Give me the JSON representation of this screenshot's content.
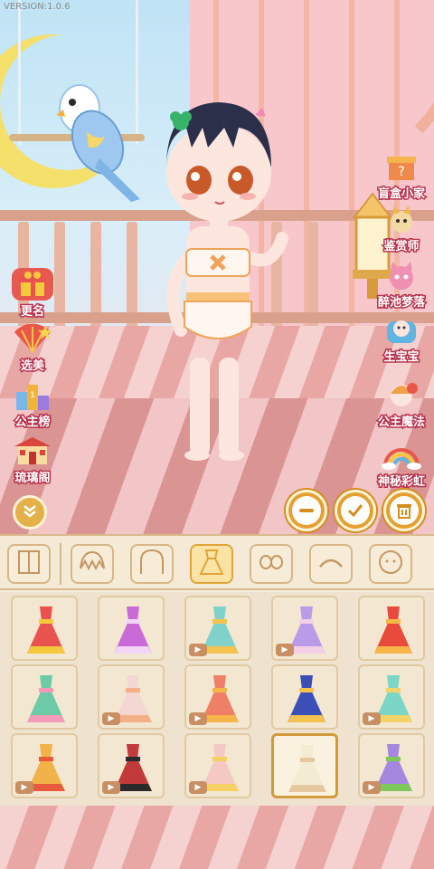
{
  "version": "VERSION:1.0.6",
  "left_menu": [
    {
      "label": "更名",
      "icon": "gift-icon",
      "color": "#e85a4f"
    },
    {
      "label": "选美",
      "icon": "fan-icon",
      "color": "#e8574a"
    },
    {
      "label": "公主榜",
      "icon": "podium-icon",
      "color": "#f0b43a"
    },
    {
      "label": "琉璃阁",
      "icon": "pavilion-icon",
      "color": "#d9463e"
    }
  ],
  "right_menu": [
    {
      "label": "盲盒小家",
      "icon": "blind-box-icon",
      "color": "#f08a4b"
    },
    {
      "label": "鉴赏师",
      "icon": "cat-appraiser-icon",
      "color": "#f3b84d"
    },
    {
      "label": "醉池梦落",
      "icon": "pink-cat-icon",
      "color": "#ef8fb2"
    },
    {
      "label": "生宝宝",
      "icon": "baby-icon",
      "color": "#5fb4e0"
    },
    {
      "label": "公主魔法",
      "icon": "princess-icon",
      "color": "#e8574a"
    },
    {
      "label": "神秘彩虹",
      "icon": "rainbow-icon",
      "color": "#7ec8ea"
    }
  ],
  "actions": {
    "remove": "minus-icon",
    "confirm": "check-icon",
    "delete": "trash-icon"
  },
  "categories": [
    {
      "name": "wardrobe",
      "icon": "wardrobe-icon",
      "active": false
    },
    {
      "name": "bangs",
      "icon": "bangs-hair-icon",
      "active": false
    },
    {
      "name": "back-hair",
      "icon": "back-hair-icon",
      "active": false
    },
    {
      "name": "dress",
      "icon": "dress-icon",
      "active": true
    },
    {
      "name": "eyes",
      "icon": "eyes-icon",
      "active": false
    },
    {
      "name": "eyebrows",
      "icon": "eyebrow-icon",
      "active": false
    },
    {
      "name": "face",
      "icon": "face-icon",
      "active": false
    }
  ],
  "outfits": [
    {
      "color": "#e8524f",
      "accent": "#f5c93c",
      "video": false,
      "selected": false
    },
    {
      "color": "#c86bd6",
      "accent": "#f3d6f7",
      "video": false,
      "selected": false
    },
    {
      "color": "#7fd1c9",
      "accent": "#f3c24f",
      "video": true,
      "selected": false
    },
    {
      "color": "#b99be8",
      "accent": "#f3d0e6",
      "video": true,
      "selected": false
    },
    {
      "color": "#e84a3c",
      "accent": "#f7b648",
      "video": false,
      "selected": false
    },
    {
      "color": "#6ccaa7",
      "accent": "#f59ab9",
      "video": false,
      "selected": false
    },
    {
      "color": "#f4d7d2",
      "accent": "#f5b08a",
      "video": true,
      "selected": false
    },
    {
      "color": "#ef7f67",
      "accent": "#f5b44c",
      "video": true,
      "selected": false
    },
    {
      "color": "#3b4fb6",
      "accent": "#f3c24f",
      "video": false,
      "selected": false
    },
    {
      "color": "#7bd6c6",
      "accent": "#f2d36a",
      "video": true,
      "selected": false
    },
    {
      "color": "#f2b24a",
      "accent": "#e85a3c",
      "video": true,
      "selected": false
    },
    {
      "color": "#c23a3a",
      "accent": "#2b2b2b",
      "video": true,
      "selected": false
    },
    {
      "color": "#f4c9c4",
      "accent": "#f5d164",
      "video": true,
      "selected": false
    },
    {
      "color": "#f3ecd3",
      "accent": "#e6c8a0",
      "video": false,
      "selected": true
    },
    {
      "color": "#a587e0",
      "accent": "#7ec85a",
      "video": true,
      "selected": false
    }
  ]
}
